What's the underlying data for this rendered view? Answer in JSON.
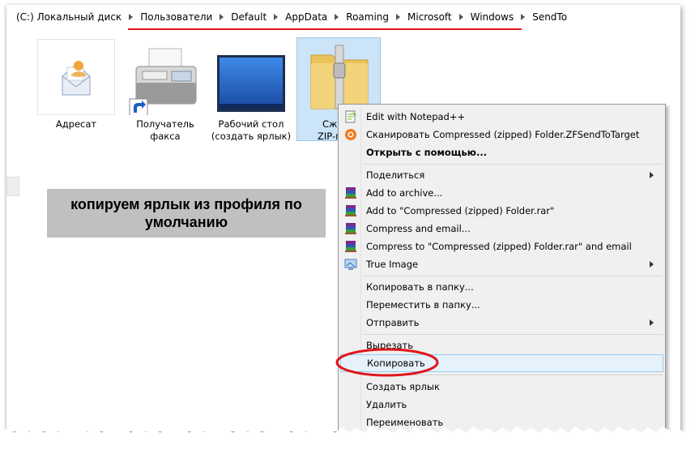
{
  "breadcrumb": {
    "items": [
      "(C:) Локальный диск",
      "Пользователи",
      "Default",
      "AppData",
      "Roaming",
      "Microsoft",
      "Windows",
      "SendTo"
    ]
  },
  "files": [
    {
      "line1": "Адресат",
      "line2": "",
      "icon": "mail-recipient-icon"
    },
    {
      "line1": "Получатель",
      "line2": "факса",
      "icon": "fax-icon"
    },
    {
      "line1": "Рабочий стол",
      "line2": "(создать ярлык)",
      "icon": "desktop-icon"
    },
    {
      "line1": "Сж",
      "line2": "ZIP-п",
      "icon": "zip-folder-icon"
    }
  ],
  "annotation": {
    "text": "копируем ярлык из профиля по умолчанию"
  },
  "context_menu": {
    "items": [
      {
        "label": "Edit with Notepad++",
        "icon": "notepadpp-icon"
      },
      {
        "label": "Сканировать Compressed (zipped) Folder.ZFSendToTarget",
        "icon": "avast-icon"
      },
      {
        "label": "Открыть с помощью...",
        "bold": true
      },
      {
        "label": "Поделиться",
        "submenu": true
      },
      {
        "label": "Add to archive...",
        "icon": "winrar-icon"
      },
      {
        "label": "Add to \"Compressed (zipped) Folder.rar\"",
        "icon": "winrar-icon"
      },
      {
        "label": "Compress and email...",
        "icon": "winrar-icon"
      },
      {
        "label": "Compress to \"Compressed (zipped) Folder.rar\" and email",
        "icon": "winrar-icon"
      },
      {
        "label": "True Image",
        "icon": "true-image-icon",
        "submenu": true
      },
      {
        "label": "Копировать в папку..."
      },
      {
        "label": "Переместить в папку..."
      },
      {
        "label": "Отправить",
        "submenu": true
      },
      {
        "label": "Вырезать"
      },
      {
        "label": "Копировать",
        "highlighted": true
      },
      {
        "label": "Создать ярлык"
      },
      {
        "label": "Удалить"
      },
      {
        "label": "Переименовать"
      }
    ]
  },
  "colors": {
    "underline": "#e0161b",
    "highlight_ellipse": "#e0161b",
    "selection": "#cce4f7",
    "annotation_bg": "#c0c0c0"
  }
}
